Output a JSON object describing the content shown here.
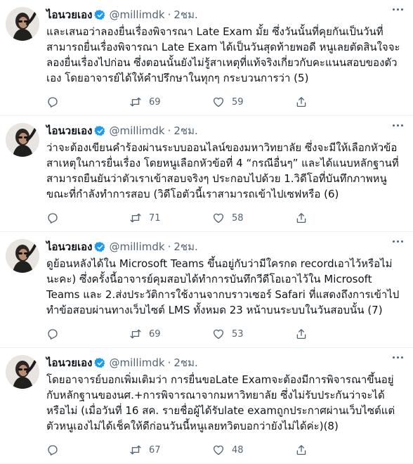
{
  "tweets": [
    {
      "name": "ไอนวยเอง",
      "handle": "@millimdk",
      "separator": "·",
      "time": "2ชม.",
      "text": "และเสนอว่าลองยื่นเรื่องพิจารณา Late Exam มั้ย ซึ่งวันนั้นที่คุยกันเป็นวันที่สามารถยื่นเรื่องพิจารณา Late Exam ได้เป็นวันสุดท้ายพอดี หนูเลยตัดสินใจจะลองยื่นเรื่องไปก่อน ซึ่งตอนนั้นยังไม่รู้สาเหตุที่แท้จริงเกี่ยวกับคะแนนสอบของตัวเอง โดยอาจารย์ได้ให้คำปรึกษาในทุกๆ กระบวนการว่า (5)",
      "retweets": "69",
      "likes": "59"
    },
    {
      "name": "ไอนวยเอง",
      "handle": "@millimdk",
      "separator": "·",
      "time": "2ชม.",
      "text": "ว่าจะต้องเขียนคำร้องผ่านระบบออนไลน์ของมหาวิทยาลัย ซึ่งจะมีให้เลือกหัวข้อสาเหตุในการยื่นเรื่อง โดยหนูเลือกหัวข้อที่ 4 “กรณีอื่นๆ” และได้แนบหลักฐานที่สามารถยืนยันว่าตัวเราเข้าสอบจริงๆ ประกอบไปด้วย 1.วิดีโอที่บันทึกภาพหนูขณะที่กำลังทำการสอบ (วิดีโอตัวนี้เราสามารถเข้าไปเซฟหรือ (6)",
      "retweets": "71",
      "likes": "58"
    },
    {
      "name": "ไอนวยเอง",
      "handle": "@millimdk",
      "separator": "·",
      "time": "2ชม.",
      "text": "ดูย้อนหลังได้ใน Microsoft Teams ขึ้นอยู่กับว่ามีใครกด recordเอาไว้หรือไม่นะคะ) ซึ่งครั้งนี้อาจารย์คุมสอบได้ทำการบันทึกวีดีโอเอาไว้ใน Microsoft Teams และ 2.ส่งประวัติการใช้งานจากบราวเซอร์ Safari ที่แสดงถึงการเข้าไปทำข้อสอบผ่านทางเว็บไซต์ LMS ทั้งหมด 23 หน้าบนระบบในวันสอบนั้น (7)",
      "retweets": "69",
      "likes": "53"
    },
    {
      "name": "ไอนวยเอง",
      "handle": "@millimdk",
      "separator": "·",
      "time": "2ชม.",
      "text": "โดยอาจารย์บอกเพิ่มเติมว่า การยื่นขอLate Examจะต้องมีการพิจารณาขึ้นอยู่กับหลักฐานของนศ.+การพิจารณาจากมหาวิทยาลัย ซึ่งไม่รับประกันว่าจะได้หรือไม่ (เมื่อวันที่ 16 สค. รายชื่อผู้ได้รับlate examถูกประกาศผ่านเว็บไซต์แต่ตัวหนูเองไม่ได้เช็คให้ดีก่อนวันนี้หนูเลยทวิตบอกว่ายังไม่ได้ค่ะ)(8)",
      "retweets": "67",
      "likes": "48"
    }
  ],
  "icons": {
    "avatar": "profile-avatar",
    "verified": "verified-badge-icon",
    "more": "more-options-icon",
    "reply": "reply-icon",
    "retweet": "retweet-icon",
    "like": "heart-icon",
    "share": "share-icon"
  },
  "colors": {
    "verified": "#1d9bf0",
    "secondary_text": "#536471",
    "divider": "#eff3f4"
  }
}
